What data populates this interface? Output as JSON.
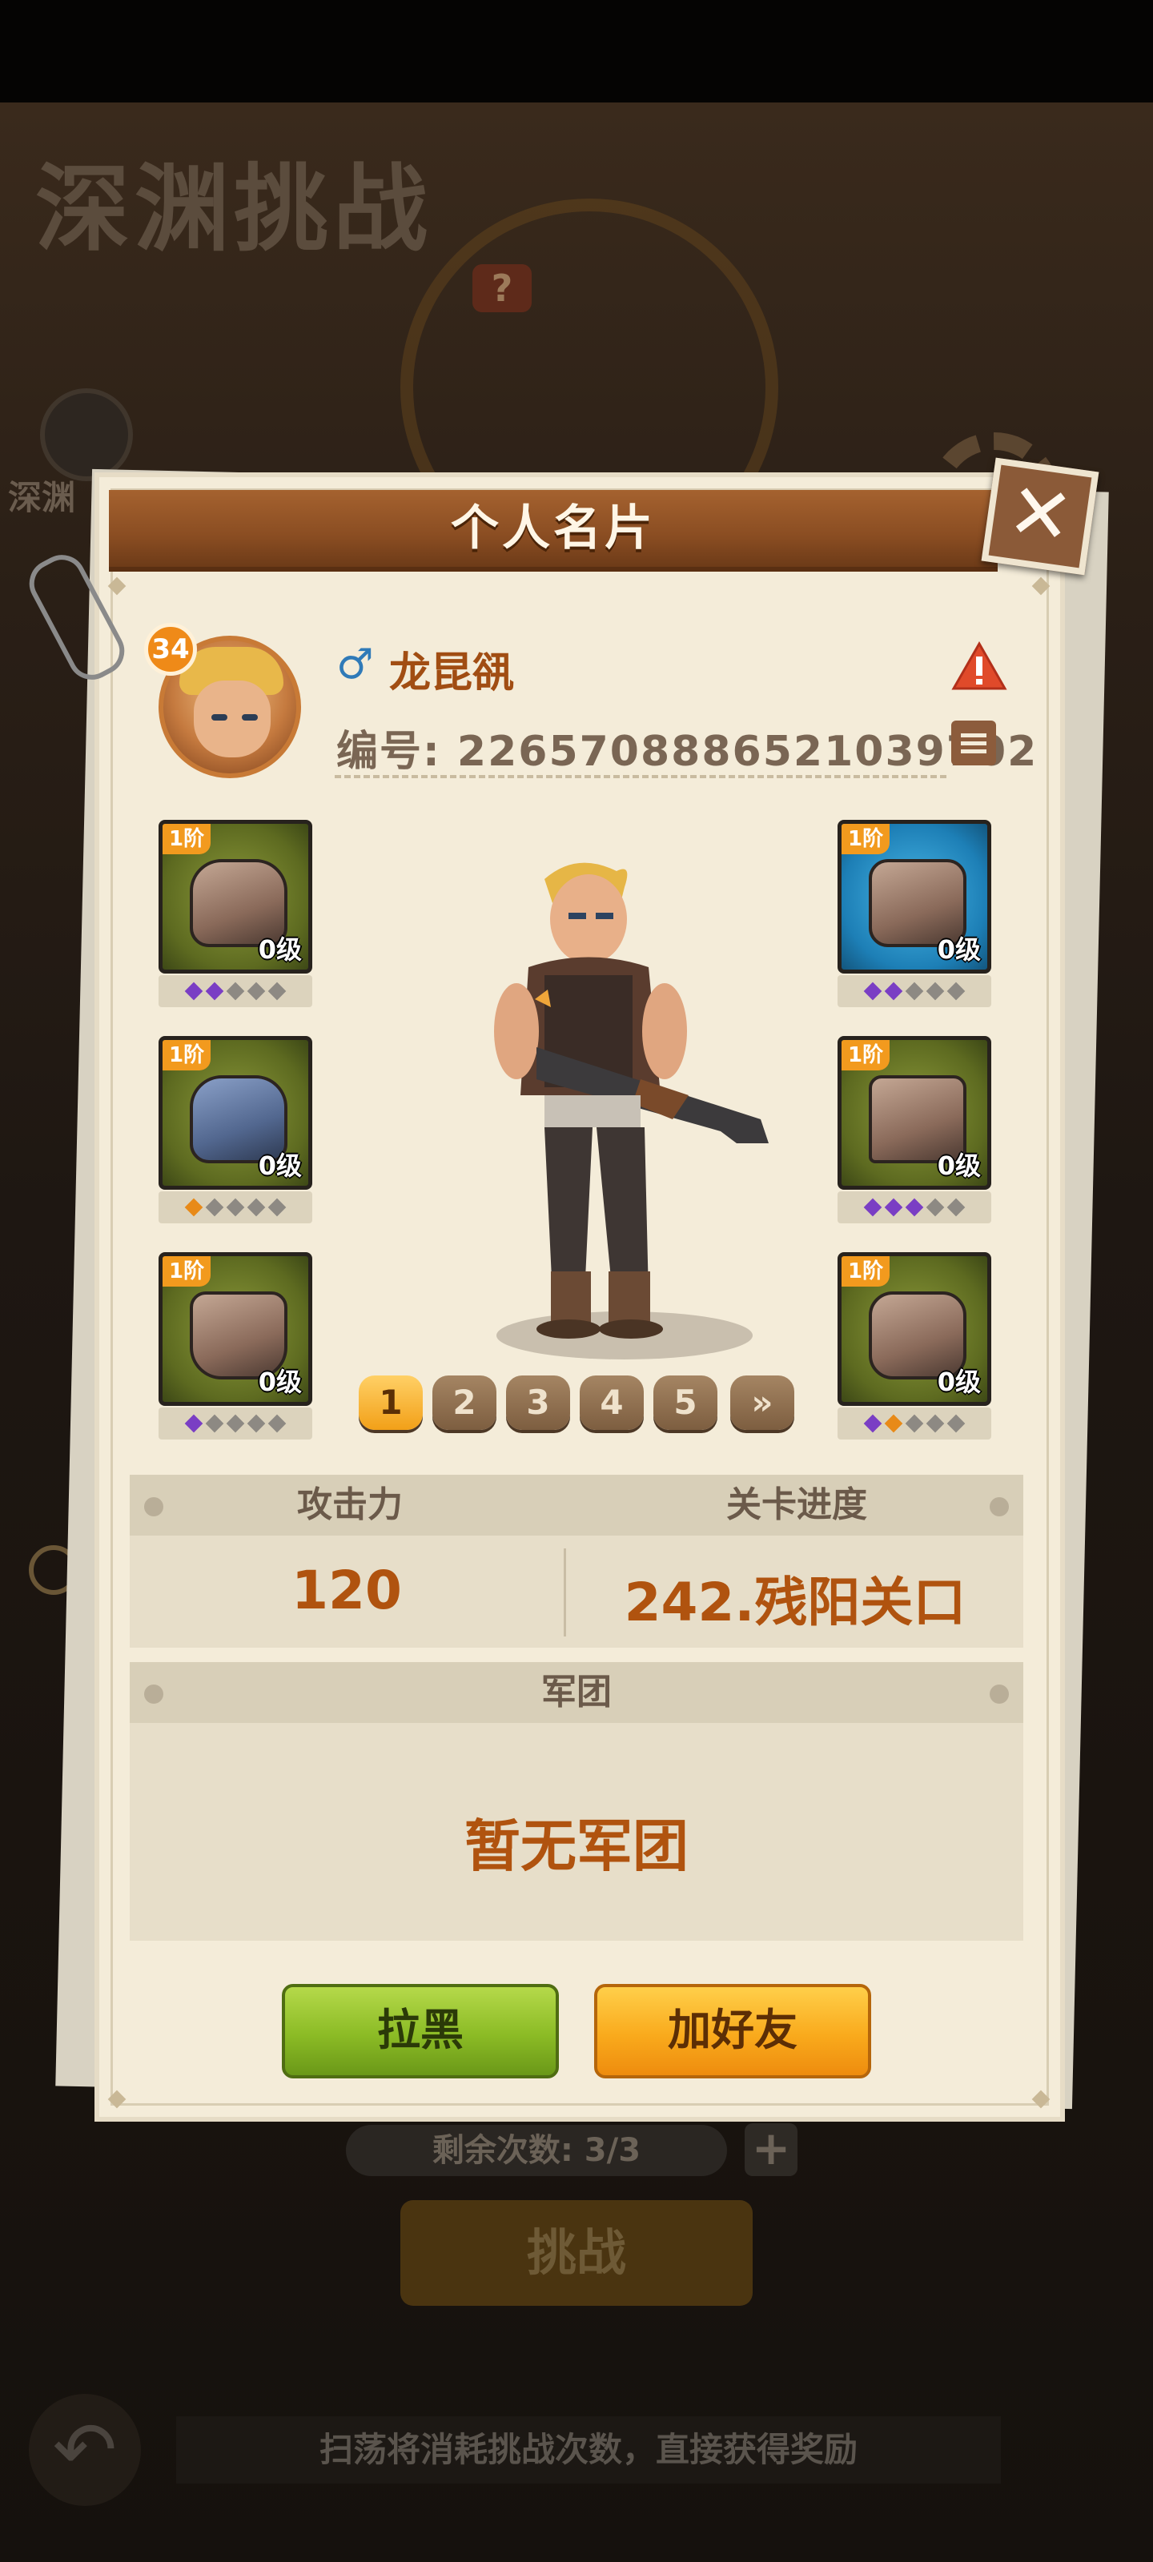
{
  "background": {
    "title": "深渊挑战",
    "help_glyph": "?",
    "left_label": "深渊",
    "remaining_label": "剩余次数: 3/3",
    "plus_glyph": "+",
    "challenge_label": "挑战",
    "sweep_hint": "扫荡将消耗挑战次数，直接获得奖励",
    "back_glyph": "↶"
  },
  "card": {
    "title": "个人名片",
    "close_glyph": "✕"
  },
  "player": {
    "level": "34",
    "gender_glyph": "♂",
    "name": "龙昆谻",
    "id_text": "编号: 22657088865210397​02"
  },
  "equipment": {
    "left": [
      {
        "tier": "1阶",
        "level": "0级",
        "gems": [
          "purple",
          "purple",
          "gray",
          "gray",
          "gray"
        ]
      },
      {
        "tier": "1阶",
        "level": "0级",
        "gems": [
          "orange",
          "gray",
          "gray",
          "gray",
          "gray"
        ]
      },
      {
        "tier": "1阶",
        "level": "0级",
        "gems": [
          "purple",
          "gray",
          "gray",
          "gray",
          "gray"
        ]
      }
    ],
    "right": [
      {
        "tier": "1阶",
        "level": "0级",
        "gems": [
          "purple",
          "purple",
          "gray",
          "gray",
          "gray"
        ]
      },
      {
        "tier": "1阶",
        "level": "0级",
        "gems": [
          "purple",
          "purple",
          "purple",
          "gray",
          "gray"
        ]
      },
      {
        "tier": "1阶",
        "level": "0级",
        "gems": [
          "purple",
          "orange",
          "gray",
          "gray",
          "gray"
        ]
      }
    ]
  },
  "pager": {
    "pages": [
      "1",
      "2",
      "3",
      "4",
      "5"
    ],
    "next_glyph": "»",
    "active": "1"
  },
  "stats": {
    "attack_label": "攻击力",
    "attack_value": "120",
    "progress_label": "关卡进度",
    "progress_value": "242.残阳关口"
  },
  "legion": {
    "label": "军团",
    "value": "暂无军团"
  },
  "actions": {
    "block_label": "拉黑",
    "add_friend_label": "加好友"
  },
  "colors": {
    "accent_orange": "#b0530f",
    "title_brown": "#8a4d22",
    "green_button": "#8bbb25",
    "orange_button": "#f9aa1c"
  }
}
